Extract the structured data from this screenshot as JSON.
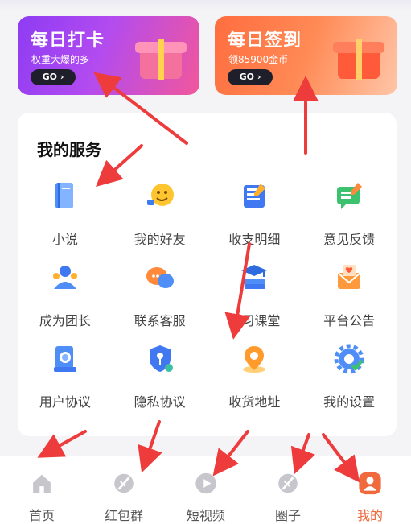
{
  "banners": {
    "checkin": {
      "title": "每日打卡",
      "subtitle": "权重大爆的多",
      "button": "GO ›"
    },
    "signin": {
      "title": "每日签到",
      "subtitle": "领85900金币",
      "button": "GO ›"
    }
  },
  "services": {
    "title": "我的服务",
    "items": [
      {
        "label": "小说",
        "icon": "book-icon"
      },
      {
        "label": "我的好友",
        "icon": "friend-emoji-icon"
      },
      {
        "label": "收支明细",
        "icon": "ledger-icon"
      },
      {
        "label": "意见反馈",
        "icon": "feedback-icon"
      },
      {
        "label": "成为团长",
        "icon": "team-leader-icon"
      },
      {
        "label": "联系客服",
        "icon": "chat-bubbles-icon"
      },
      {
        "label": "学习课堂",
        "icon": "graduation-books-icon"
      },
      {
        "label": "平台公告",
        "icon": "announcement-envelope-icon"
      },
      {
        "label": "用户协议",
        "icon": "document-search-icon"
      },
      {
        "label": "隐私协议",
        "icon": "shield-key-icon"
      },
      {
        "label": "收货地址",
        "icon": "location-pin-icon"
      },
      {
        "label": "我的设置",
        "icon": "settings-gear-icon"
      }
    ]
  },
  "tabbar": {
    "items": [
      {
        "label": "首页",
        "icon": "home-icon"
      },
      {
        "label": "红包群",
        "icon": "red-packet-group-icon"
      },
      {
        "label": "短视频",
        "icon": "play-icon"
      },
      {
        "label": "圈子",
        "icon": "circle-icon"
      },
      {
        "label": "我的",
        "icon": "profile-icon"
      }
    ],
    "active_index": 4
  },
  "colors": {
    "accent": "#f06a3e",
    "annotation_arrow": "#ee3b3b",
    "checkin_gradient": [
      "#8e3cf3",
      "#f2579b"
    ],
    "signin_gradient": [
      "#ff6d3f",
      "#ffc6a8"
    ]
  }
}
